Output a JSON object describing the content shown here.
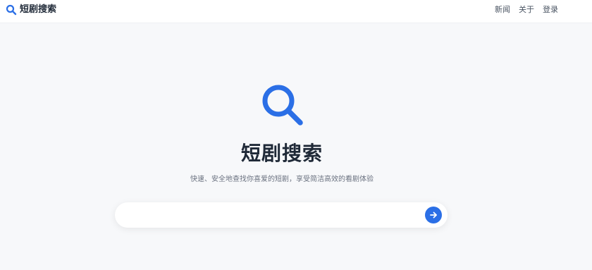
{
  "header": {
    "logo_text": "短剧搜索",
    "nav": [
      "新闻",
      "关于",
      "登录"
    ]
  },
  "hero": {
    "title": "短剧搜索",
    "subtitle": "快速、安全地查找你喜爱的短剧，享受简洁高效的看剧体验"
  },
  "search": {
    "value": "",
    "placeholder": ""
  },
  "colors": {
    "accent": "#2b6fe6",
    "background": "#f7f8fa"
  },
  "icons": {
    "logo": "search-icon",
    "hero": "search-icon",
    "submit": "arrow-right-icon"
  }
}
